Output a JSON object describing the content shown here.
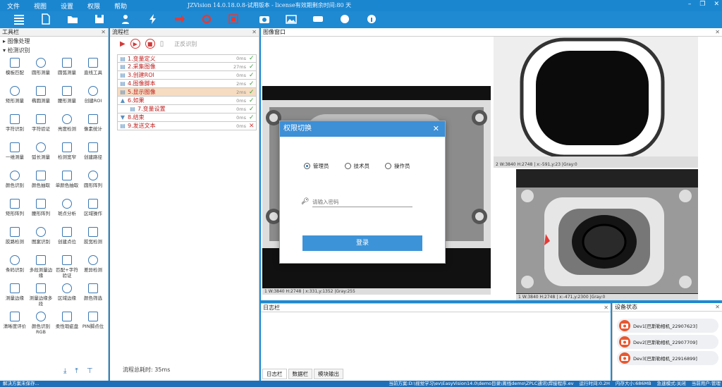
{
  "menu": [
    "文件",
    "视图",
    "设置",
    "权限",
    "帮助"
  ],
  "app_title": "JZVision 14.0.18.0.8-试用版本 - license有效期剩余时间:80 天",
  "toolbox": {
    "title": "工具栏",
    "section_image": "图像处理",
    "section_detect": "检测识别",
    "tools": [
      "模板匹配",
      "圆形测量",
      "圆弧测量",
      "直线工具",
      "矩形测量",
      "椭圆测量",
      "腰形测量",
      "创建ROI",
      "字符识别",
      "字符验证",
      "亮度检测",
      "像素统计",
      "一维测量",
      "弧长测量",
      "检测宽窄",
      "创建路径",
      "颜色识别",
      "颜色抽取",
      "单颜色抽取",
      "圆形阵列",
      "矩形阵列",
      "腰形阵列",
      "斑点分析",
      "区域操作",
      "胶路检测",
      "图案识别",
      "创建点位",
      "胶宽检测",
      "条码识别",
      "多段测量边缘",
      "匹配+字符验证",
      "差异检测",
      "测量边缘",
      "测量边缘多段",
      "区域边缘",
      "颜色筛选",
      "清晰度评价",
      "颜色识别RGB",
      "柔性瑕疵盘",
      "PIN脚点位"
    ]
  },
  "flow": {
    "title": "流程栏",
    "toolbar_label": "正反识别",
    "steps": [
      {
        "label": "1.变量定义",
        "time": "0ms",
        "ok": true
      },
      {
        "label": "2.采集图像",
        "time": "27ms",
        "ok": true
      },
      {
        "label": "3.创建ROI",
        "time": "0ms",
        "ok": true
      },
      {
        "label": "4.图像脚本",
        "time": "2ms",
        "ok": true
      },
      {
        "label": "5.显示图像",
        "time": "2ms",
        "ok": true
      },
      {
        "label": "6.如果",
        "time": "0ms",
        "ok": true
      },
      {
        "label": "7.变量设置",
        "time": "0ms",
        "ok": true
      },
      {
        "label": "8.结束",
        "time": "0ms",
        "ok": true
      },
      {
        "label": "9.发送文本",
        "time": "0ms",
        "ok": false
      }
    ],
    "total_time": "流程总耗时: 35ms"
  },
  "image_window": {
    "title": "图像窗口",
    "status": [
      "1 W:3840 H:2748 | x:331,y:1352 |Gray:255",
      "2 W:3840 H:2748 | x:-591,y:23 |Gray:0",
      "1 W:3840 H:2748 | x:-471,y:2300 |Gray:0"
    ]
  },
  "dialog": {
    "title": "权限切换",
    "roles": [
      "管理员",
      "技术员",
      "操作员"
    ],
    "selected": 0,
    "password_placeholder": "请输入密码",
    "login": "登录"
  },
  "log": {
    "title": "日志栏",
    "tabs": [
      "日志栏",
      "数据栏",
      "模块输出"
    ]
  },
  "devices": {
    "title": "设备状态",
    "list": [
      "Dev1[巴斯勒相机_22907623]",
      "Dev2[巴斯勒相机_22907709]",
      "Dev3[巴斯勒相机_22916899]"
    ]
  },
  "statusbar": {
    "left": "解决方案未保存...",
    "right": [
      "当前方案:D:\\视觉学习\\ev\\EasyVision14.0\\demo目录\\离线demo\\ZPLC通讯\\焊接程序.ev",
      "运行时间:0.2H",
      "内存大小:686MB",
      "急速模式:关闭",
      "当前用户:管理"
    ]
  }
}
